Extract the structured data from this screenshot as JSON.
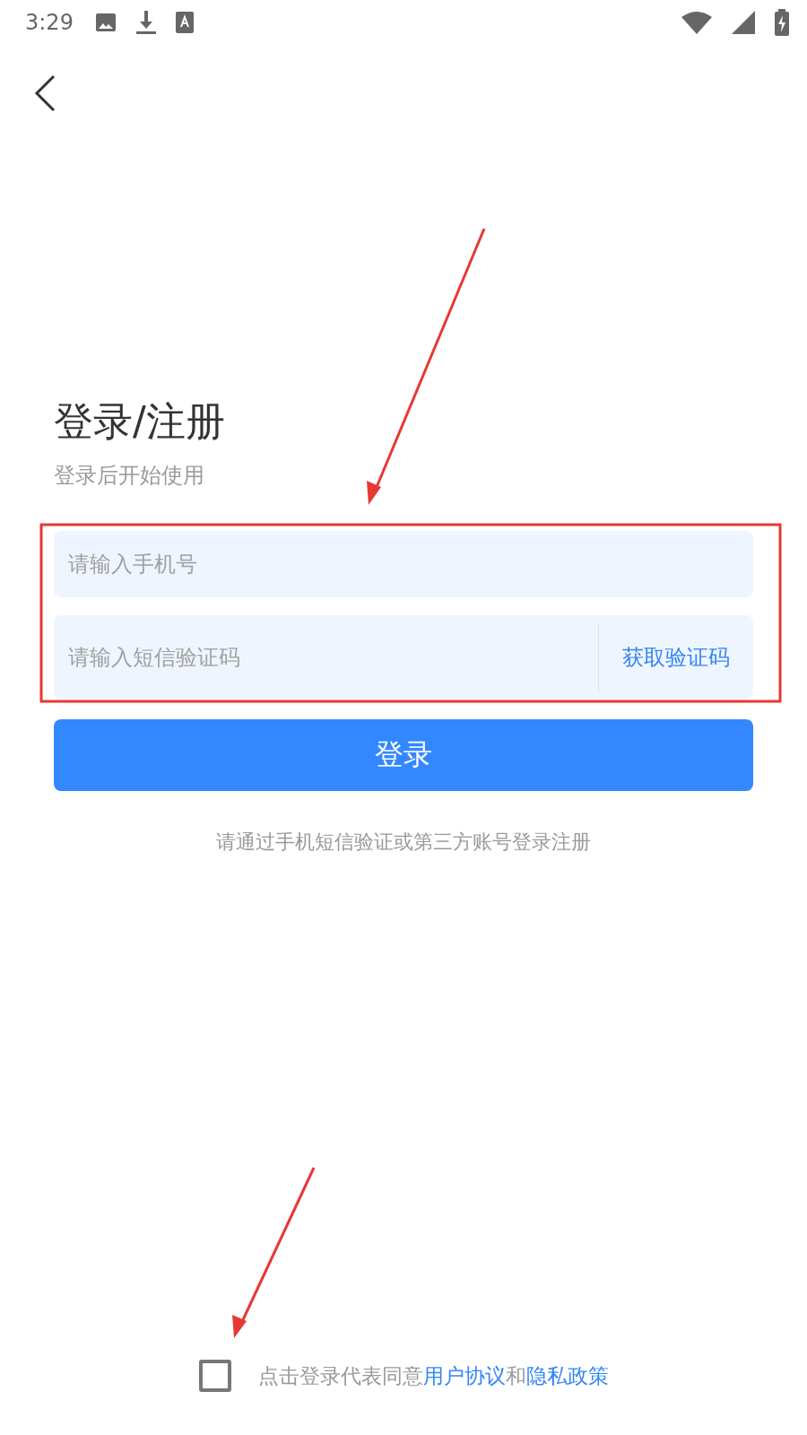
{
  "status_bar": {
    "time": "3:29"
  },
  "header": {
    "title": "登录/注册",
    "subtitle": "登录后开始使用"
  },
  "phone_field": {
    "placeholder": "请输入手机号"
  },
  "code_field": {
    "placeholder": "请输入短信验证码",
    "action": "获取验证码"
  },
  "login_button": "登录",
  "hint": "请通过手机短信验证或第三方账号登录注册",
  "agreement": {
    "checked": false,
    "parts": [
      {
        "kind": "plain",
        "text": "点击登录代表同意"
      },
      {
        "kind": "link",
        "text": "用户协议"
      },
      {
        "kind": "plain",
        "text": "和"
      },
      {
        "kind": "link",
        "text": "隐私政策"
      }
    ]
  }
}
